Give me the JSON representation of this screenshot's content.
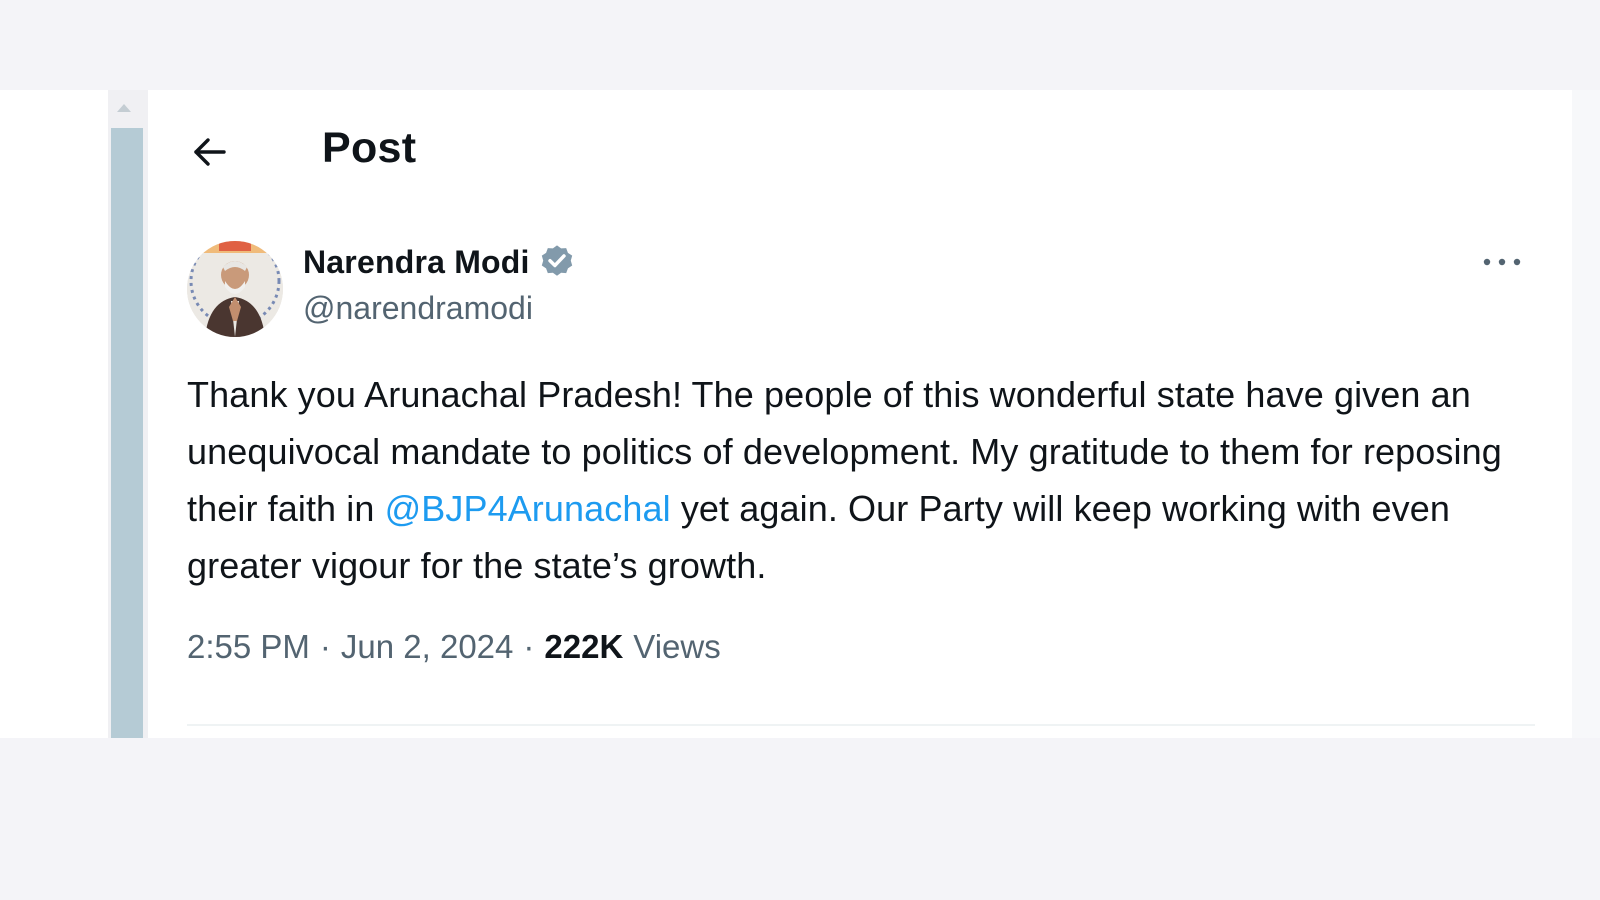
{
  "header": {
    "title": "Post",
    "back_icon": "arrow-left-icon"
  },
  "post": {
    "author": {
      "name": "Narendra Modi",
      "handle": "@narendramodi",
      "verified": true,
      "verified_icon": "verified-badge-icon",
      "verified_color": "#829aab"
    },
    "more_icon": "ellipsis-icon",
    "text_before_mention": "Thank you Arunachal Pradesh! The people of this wonderful state have given an unequivocal mandate to politics of development. My gratitude to them for reposing their faith in ",
    "mention": "@BJP4Arunachal",
    "text_after_mention": " yet again. Our Party will keep working with even greater vigour for the state’s growth.",
    "time": "2:55 PM",
    "separator": "·",
    "date": "Jun 2, 2024",
    "views_count": "222K",
    "views_label": "Views"
  },
  "colors": {
    "link": "#1d9bf0",
    "text_primary": "#0f1419",
    "text_secondary": "#536471",
    "scroll_thumb": "#b5cbd5"
  }
}
